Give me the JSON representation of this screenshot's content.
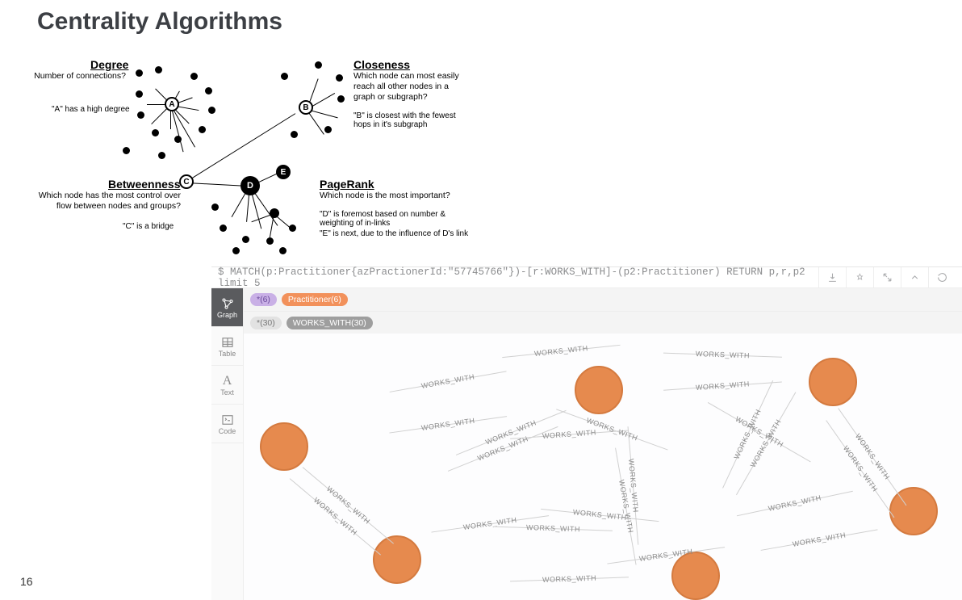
{
  "page": {
    "title": "Centrality Algorithms",
    "number": "16"
  },
  "diagram": {
    "degree": {
      "heading": "Degree",
      "desc": "Number of connections?",
      "note": "\"A\" has a high degree"
    },
    "closeness": {
      "heading": "Closeness",
      "desc": "Which node can most easily reach all other nodes in a graph or subgraph?",
      "note": "\"B\" is closest with the fewest hops in it's subgraph"
    },
    "betweenness": {
      "heading": "Betweenness",
      "desc": "Which node has the most control over flow between nodes and groups?",
      "note": "\"C\" is a bridge"
    },
    "pagerank": {
      "heading": "PageRank",
      "desc": "Which node is the most important?",
      "note1": "\"D\" is foremost based on number & weighting of in-links",
      "note2": "\"E\" is next, due to the influence of D's link"
    },
    "node_labels": {
      "A": "A",
      "B": "B",
      "C": "C",
      "D": "D",
      "E": "E"
    }
  },
  "neo4j": {
    "query": "$ MATCH(p:Practitioner{azPractionerId:\"57745766\"})-[r:WORKS_WITH]-(p2:Practitioner) RETURN p,r,p2 limit 5",
    "tabs": {
      "graph": "Graph",
      "table": "Table",
      "text": "Text",
      "code": "Code"
    },
    "pills": {
      "star6": "*(6)",
      "practitioner": "Practitioner(6)",
      "star30": "*(30)",
      "works_with": "WORKS_WITH(30)"
    },
    "relationship_label": "WORKS_WITH"
  }
}
